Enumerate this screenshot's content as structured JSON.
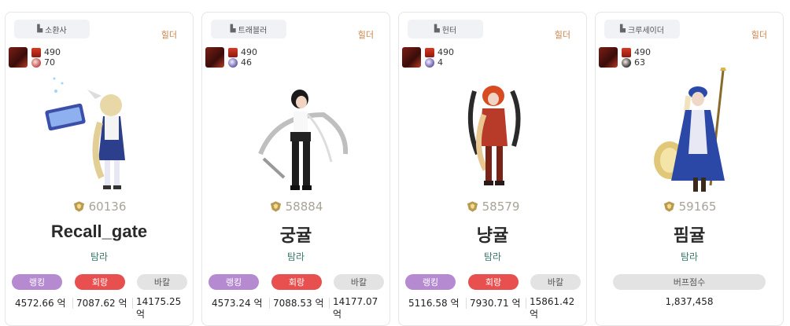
{
  "cards": [
    {
      "job": "소환사",
      "role": "힐더",
      "stat_top": "490",
      "stat_bottom": "70",
      "score": "60136",
      "name": "Recall_gate",
      "server": "탐라",
      "labels": [
        "랭킹",
        "회랑",
        "바칼"
      ],
      "values": [
        "4572.66 억",
        "7087.62 억",
        "14175.25 억"
      ]
    },
    {
      "job": "트래블러",
      "role": "힐더",
      "stat_top": "490",
      "stat_bottom": "46",
      "score": "58884",
      "name": "궁귤",
      "server": "탐라",
      "labels": [
        "랭킹",
        "회랑",
        "바칼"
      ],
      "values": [
        "4573.24 억",
        "7088.53 억",
        "14177.07 억"
      ]
    },
    {
      "job": "헌터",
      "role": "힐더",
      "stat_top": "490",
      "stat_bottom": "4",
      "score": "58579",
      "name": "냥귤",
      "server": "탐라",
      "labels": [
        "랭킹",
        "회랑",
        "바칼"
      ],
      "values": [
        "5116.58 억",
        "7930.71 억",
        "15861.42 억"
      ]
    },
    {
      "job": "크루세이더",
      "role": "힐더",
      "stat_top": "490",
      "stat_bottom": "63",
      "score": "59165",
      "name": "핌귤",
      "server": "탐라",
      "buff_label": "버프점수",
      "buff_value": "1,837,458"
    }
  ],
  "colors": {
    "rank_pill": "#b58ad1",
    "heal_pill": "#e8504f",
    "gray_pill": "#e3e3e3",
    "role_text": "#c8834a",
    "server_text": "#3a7a6a"
  }
}
